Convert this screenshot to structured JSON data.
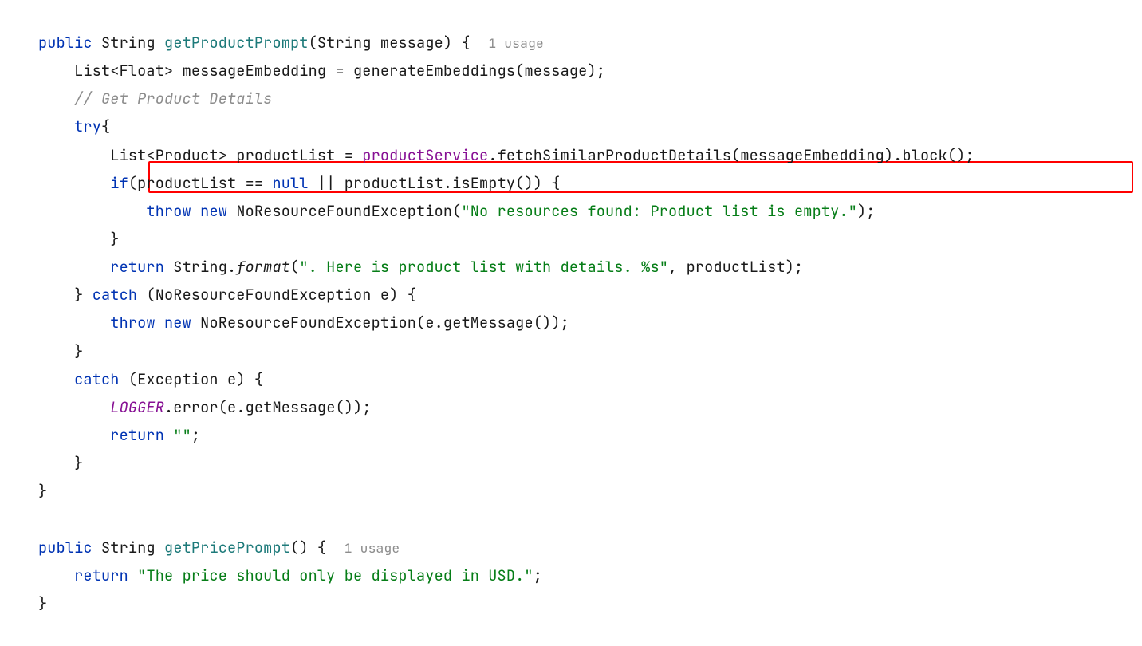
{
  "tokens": {
    "kw_public": "public",
    "kw_try": "try",
    "kw_if": "if",
    "kw_throw": "throw",
    "kw_new": "new",
    "kw_return": "return",
    "kw_catch": "catch",
    "kw_null": "null",
    "type_String": "String",
    "type_List": "List",
    "type_Float": "Float",
    "type_Product": "Product",
    "type_NoResourceFoundException": "NoResourceFoundException",
    "type_Exception": "Exception",
    "method_getProductPrompt": "getProductPrompt",
    "method_getPricePrompt": "getPricePrompt",
    "param_message": "message",
    "var_messageEmbedding": "messageEmbedding",
    "var_productList": "productList",
    "var_e": "e",
    "field_productService": "productService",
    "field_LOGGER": "LOGGER",
    "call_generateEmbeddings": "generateEmbeddings",
    "call_fetchSimilarProductDetails": "fetchSimilarProductDetails",
    "call_block": "block",
    "call_isEmpty": "isEmpty",
    "call_format": "format",
    "call_getMessage": "getMessage",
    "call_error": "error",
    "comment_getProductDetails": "// Get Product Details",
    "usage_1": "1 usage",
    "str_noResources": "\"No resources found: Product list is empty.\"",
    "str_hereIsList": "\". Here is product list with details. %s\"",
    "str_empty": "\"\"",
    "str_priceUsd": "\"The price should only be displayed in USD.\""
  }
}
